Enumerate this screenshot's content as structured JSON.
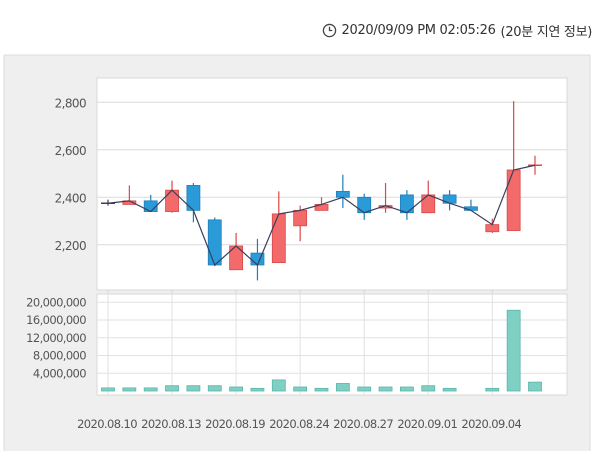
{
  "header": {
    "icon": "clock-icon",
    "timestamp": "2020/09/09 PM 02:05:26",
    "delay_note": "(20분 지연 정보)"
  },
  "colors": {
    "up": "#f26a6a",
    "down": "#2a9ad8",
    "volume": "#7fd0c4",
    "line": "#3a3f5c",
    "panel": "#efefef"
  },
  "chart_data": [
    {
      "type": "candlestick",
      "ylim": [
        2000,
        2830
      ],
      "yticks": [
        "2,200",
        "2,400",
        "2,600",
        "2,800"
      ],
      "ytick_values": [
        2200,
        2400,
        2600,
        2800
      ],
      "grid": true,
      "ohlc": [
        [
          2375,
          2390,
          2365,
          2375
        ],
        [
          2370,
          2450,
          2370,
          2385
        ],
        [
          2385,
          2410,
          2340,
          2340
        ],
        [
          2340,
          2470,
          2335,
          2430
        ],
        [
          2450,
          2460,
          2295,
          2345
        ],
        [
          2305,
          2315,
          2110,
          2115
        ],
        [
          2095,
          2250,
          2095,
          2195
        ],
        [
          2165,
          2225,
          2050,
          2115
        ],
        [
          2125,
          2425,
          2125,
          2330
        ],
        [
          2280,
          2365,
          2215,
          2345
        ],
        [
          2345,
          2400,
          2345,
          2370
        ],
        [
          2425,
          2495,
          2355,
          2400
        ],
        [
          2400,
          2415,
          2305,
          2335
        ],
        [
          2355,
          2460,
          2335,
          2365
        ],
        [
          2410,
          2430,
          2305,
          2335
        ],
        [
          2335,
          2470,
          2335,
          2410
        ],
        [
          2410,
          2430,
          2345,
          2375
        ],
        [
          2360,
          2390,
          2345,
          2345
        ],
        [
          2255,
          2310,
          2250,
          2285
        ],
        [
          2260,
          2805,
          2260,
          2515
        ],
        [
          2535,
          2575,
          2495,
          2535
        ]
      ]
    },
    {
      "type": "bar",
      "ylim": [
        0,
        21000000
      ],
      "yticks": [
        "4,000,000",
        "8,000,000",
        "12,000,000",
        "16,000,000",
        "20,000,000"
      ],
      "ytick_values": [
        4000000,
        8000000,
        12000000,
        16000000,
        20000000
      ],
      "values": [
        700000,
        700000,
        700000,
        1200000,
        1200000,
        1200000,
        900000,
        600000,
        2500000,
        900000,
        600000,
        1700000,
        900000,
        900000,
        900000,
        1200000,
        600000,
        0,
        600000,
        18200000,
        2000000
      ],
      "xtick_labels": [
        "2020.08.10",
        "2020.08.13",
        "2020.08.19",
        "2020.08.24",
        "2020.08.27",
        "2020.09.01",
        "2020.09.04"
      ],
      "xtick_index": [
        0,
        3,
        6,
        9,
        12,
        15,
        18
      ]
    }
  ]
}
